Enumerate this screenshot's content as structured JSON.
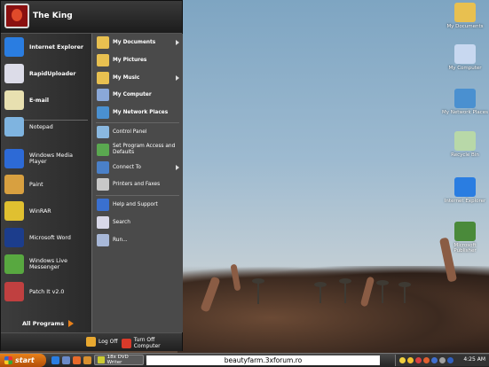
{
  "user": {
    "name": "The King"
  },
  "start_menu": {
    "pinned": [
      {
        "label": "Internet Explorer",
        "icon": "internet-explorer-icon",
        "color": "#2a7de1"
      },
      {
        "label": "RapidUploader",
        "icon": "rapiduploader-icon",
        "color": "#dcdce8"
      },
      {
        "label": "E-mail",
        "icon": "email-icon",
        "color": "#e8e0b0"
      }
    ],
    "recent": [
      {
        "label": "Notepad",
        "icon": "notepad-icon",
        "color": "#7fb4e0"
      },
      {
        "label": "Windows Media Player",
        "icon": "media-player-icon",
        "color": "#2d6ad6"
      },
      {
        "label": "Paint",
        "icon": "paint-icon",
        "color": "#d8a040"
      },
      {
        "label": "WinRAR",
        "icon": "winrar-icon",
        "color": "#e0c030"
      },
      {
        "label": "Microsoft Word",
        "icon": "word-icon",
        "color": "#1c3d8c"
      },
      {
        "label": "Windows Live Messenger",
        "icon": "messenger-icon",
        "color": "#58a840"
      },
      {
        "label": "Patch It v2.0",
        "icon": "patch-icon",
        "color": "#c04040"
      }
    ],
    "all_programs": "All Programs",
    "places": [
      {
        "label": "My Documents",
        "icon": "documents-folder-icon",
        "color": "#e8c050",
        "arrow": true
      },
      {
        "label": "My Pictures",
        "icon": "pictures-folder-icon",
        "color": "#e8c050",
        "arrow": false
      },
      {
        "label": "My Music",
        "icon": "music-folder-icon",
        "color": "#e8c050",
        "arrow": true
      },
      {
        "label": "My Computer",
        "icon": "computer-icon",
        "color": "#8aa8d8",
        "arrow": false
      },
      {
        "label": "My Network Places",
        "icon": "network-icon",
        "color": "#4a90d0",
        "arrow": false
      }
    ],
    "system": [
      {
        "label": "Control Panel",
        "icon": "control-panel-icon",
        "color": "#8ab8e0",
        "arrow": false
      },
      {
        "label": "Set Program Access and Defaults",
        "icon": "program-access-icon",
        "color": "#5aa850",
        "arrow": false
      },
      {
        "label": "Connect To",
        "icon": "connect-icon",
        "color": "#4a80c8",
        "arrow": true
      },
      {
        "label": "Printers and Faxes",
        "icon": "printer-icon",
        "color": "#c8c8c8",
        "arrow": false
      }
    ],
    "help": [
      {
        "label": "Help and Support",
        "icon": "help-icon",
        "color": "#3a70d0",
        "arrow": false
      },
      {
        "label": "Search",
        "icon": "search-icon",
        "color": "#d8d8e8",
        "arrow": false
      },
      {
        "label": "Run...",
        "icon": "run-icon",
        "color": "#a8b8d8",
        "arrow": false
      }
    ],
    "log_off": "Log Off",
    "turn_off": "Turn Off Computer"
  },
  "desktop_icons": [
    {
      "label": "My Documents",
      "icon": "documents-folder-icon",
      "color": "#e8c050"
    },
    {
      "label": "My Computer",
      "icon": "computer-icon",
      "color": "#c8d8f0"
    },
    {
      "label": "My Network Places",
      "icon": "network-icon",
      "color": "#4a90d0"
    },
    {
      "label": "Recycle Bin",
      "icon": "recycle-bin-icon",
      "color": "#b8d8a8"
    },
    {
      "label": "Internet Explorer",
      "icon": "internet-explorer-icon",
      "color": "#2a7de1"
    },
    {
      "label": "Microsoft Publisher",
      "icon": "publisher-icon",
      "color": "#4a8a3a"
    }
  ],
  "taskbar": {
    "start_label": "start",
    "task_label": "18x DVD Writer",
    "watermark": "beautyfarm.3xforum.ro",
    "clock": "4:25 AM"
  },
  "colors": {
    "start_button": "#d86a14",
    "menu_bg": "#2f2f2f",
    "accent": "#e8801a"
  }
}
